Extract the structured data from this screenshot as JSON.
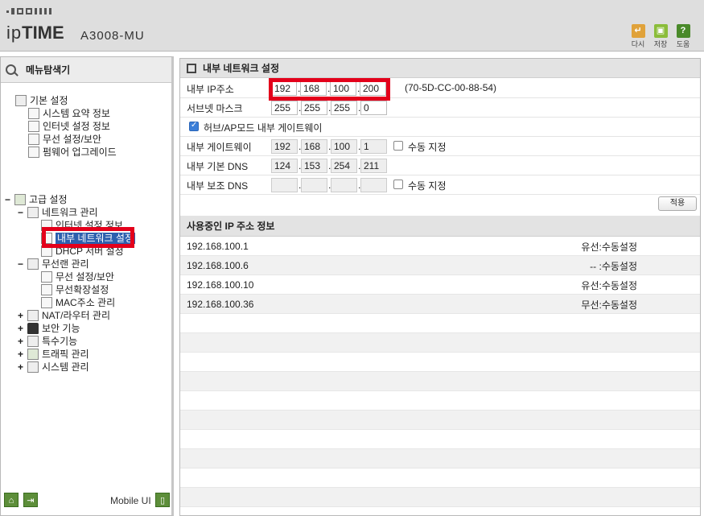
{
  "header": {
    "brand_prefix": "ip",
    "brand_main": "TIME",
    "model": "A3008-MU",
    "buttons": [
      {
        "label": "다시",
        "icon": "undo-icon",
        "color": "#e0a23a"
      },
      {
        "label": "저장",
        "icon": "save-icon",
        "color": "#8bbd3a"
      },
      {
        "label": "도움",
        "icon": "help-icon",
        "color": "#5a9a2a"
      }
    ]
  },
  "sidebar": {
    "title": "메뉴탐색기",
    "basic": {
      "label": "기본 설정",
      "items": [
        "시스템 요약 정보",
        "인터넷 설정 정보",
        "무선 설정/보안",
        "펌웨어 업그레이드"
      ]
    },
    "advanced": {
      "label": "고급 설정",
      "network": {
        "label": "네트워크 관리",
        "items": [
          "인터넷 설정 정보",
          "내부 네트워크 설정",
          "DHCP 서버 설정"
        ]
      },
      "wireless": {
        "label": "무선랜 관리",
        "items": [
          "무선 설정/보안",
          "무선확장설정",
          "MAC주소 관리"
        ]
      },
      "others": [
        "NAT/라우터 관리",
        "보안 기능",
        "특수기능",
        "트래픽 관리",
        "시스템 관리"
      ]
    },
    "footer": {
      "mobile_label": "Mobile UI"
    }
  },
  "main": {
    "title": "내부 네트워크 설정",
    "ip_label": "내부 IP주소",
    "ip": [
      "192",
      "168",
      "100",
      "200"
    ],
    "mac": "(70-5D-CC-00-88-54)",
    "subnet_label": "서브넷 마스크",
    "subnet": [
      "255",
      "255",
      "255",
      "0"
    ],
    "hub_mode_label": "허브/AP모드 내부 게이트웨이",
    "gateway_label": "내부 게이트웨이",
    "gateway": [
      "192",
      "168",
      "100",
      "1"
    ],
    "manual_label": "수동 지정",
    "dns1_label": "내부 기본 DNS",
    "dns1": [
      "124",
      "153",
      "254",
      "211"
    ],
    "dns2_label": "내부 보조 DNS",
    "dns2": [
      "",
      "",
      "",
      ""
    ],
    "apply_label": "적용",
    "ip_info_title": "사용중인 IP 주소 정보",
    "ip_list": [
      {
        "ip": "192.168.100.1",
        "status": "유선:수동설정"
      },
      {
        "ip": "192.168.100.6",
        "status": "-- :수동설정"
      },
      {
        "ip": "192.168.100.10",
        "status": "유선:수동설정"
      },
      {
        "ip": "192.168.100.36",
        "status": "무선:수동설정"
      }
    ]
  }
}
